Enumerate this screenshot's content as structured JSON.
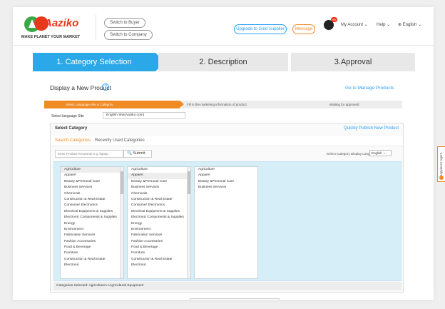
{
  "header": {
    "logo_text": "Aaziko",
    "tagline": "MAKE PLANET YOUR MARKET",
    "switch_buyer": "Switch to Buyer",
    "switch_company": "Switch to Company",
    "upgrade": "Upgrade to Gold Supplier",
    "message": "Message",
    "badge": "99",
    "my_account": "My Account ⌄",
    "help": "Help ⌄",
    "language": "⊕ English ⌄"
  },
  "steps": [
    "1. Category Selection",
    "2. Description",
    "3.Approval"
  ],
  "page": {
    "title": "Display a New Product",
    "help_icon": "?",
    "manage_link": "Go to Manage Products"
  },
  "substeps": [
    "Select Language Site & Category",
    "Fill in the marketing information of product",
    "Waiting for approved"
  ],
  "language_site": {
    "label": "Select language Site",
    "value": "English Site(Aaziko.com)"
  },
  "category_panel": {
    "title": "Select Category",
    "quick_link": "Quickly Publish New Product",
    "tabs": [
      "Search Categories",
      "Recently Used Categories"
    ],
    "display_lang_label": "Select Category Display Language",
    "display_lang_value": "English ⌄",
    "keyword_placeholder": "Enter Product Keywords e.g. laptop",
    "submit": "🔍 Submit",
    "list1": [
      "Agriculture",
      "Apparel",
      "Beauty &Personal Care",
      "Business Services",
      "Chemicals",
      "Construction & Real Estate",
      "Consumer Electronics",
      "Electrical Equipment & Supplies",
      "Electronic Components & Supplies",
      "Energy",
      "Environment",
      "Fabrication Services",
      "Fashion Accessories",
      "Food & Beverage",
      "Furniture",
      "Construction & Real Estate",
      "Electronic"
    ],
    "list2": [
      "Agriculture",
      "Apparel",
      "Beauty &Personal Care",
      "Business Services",
      "Chemicals",
      "Construction & Real Estate",
      "Consumer Electronics",
      "Electrical Equipment & Supplies",
      "Electronic Components & Supplies",
      "Energy",
      "Environment",
      "Fabrication Services",
      "Fashion Accessories",
      "Food & Beverage",
      "Furniture",
      "Construction & Real Estate",
      "Electronic"
    ],
    "list3": [
      "Agriculture",
      "Apparel",
      "Beauty &Personal Care",
      "Business Services"
    ],
    "selected_text": "Categories Selected: Agriculture>>Agricultural Equipment"
  },
  "side_tab": "Happiness Agent",
  "colors": {
    "blue": "#2aa8e8",
    "orange": "#f08a24",
    "red": "#e8381b",
    "green": "#3aa843"
  }
}
